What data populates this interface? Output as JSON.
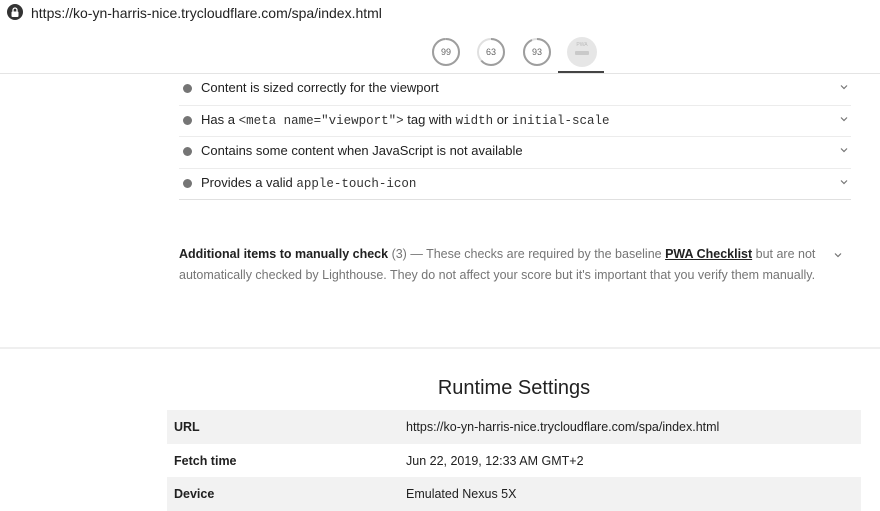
{
  "url_bar": {
    "lock_icon": "lock-icon",
    "url": "https://ko-yn-harris-nice.trycloudflare.com/spa/index.html"
  },
  "scores": [
    {
      "name": "performance",
      "value": "99",
      "fraction": 0.99,
      "color": "#9e9e9e"
    },
    {
      "name": "accessibility",
      "value": "63",
      "fraction": 0.63,
      "color": "#9e9e9e"
    },
    {
      "name": "best-practices",
      "value": "93",
      "fraction": 0.93,
      "color": "#9e9e9e"
    }
  ],
  "pwa_badge": {
    "label": "PWA",
    "icon": "pwa-badge-icon"
  },
  "audits": [
    {
      "parts": [
        {
          "t": "text",
          "v": "Content is sized correctly for the viewport"
        }
      ]
    },
    {
      "parts": [
        {
          "t": "text",
          "v": "Has a "
        },
        {
          "t": "code",
          "v": "<meta name=\"viewport\">"
        },
        {
          "t": "text",
          "v": " tag with "
        },
        {
          "t": "code",
          "v": "width"
        },
        {
          "t": "text",
          "v": " or "
        },
        {
          "t": "code",
          "v": "initial-scale"
        }
      ]
    },
    {
      "parts": [
        {
          "t": "text",
          "v": "Contains some content when JavaScript is not available"
        }
      ]
    },
    {
      "parts": [
        {
          "t": "text",
          "v": "Provides a valid "
        },
        {
          "t": "code",
          "v": "apple-touch-icon"
        }
      ]
    }
  ],
  "manual_check": {
    "title": "Additional items to manually check",
    "count": "(3)",
    "desc_before": " — These checks are required by the baseline ",
    "link": "PWA Checklist",
    "desc_after": " but are not automatically checked by Lighthouse. They do not affect your score but it's important that you verify them manually."
  },
  "runtime": {
    "title": "Runtime Settings",
    "rows": [
      {
        "key": "URL",
        "value": "https://ko-yn-harris-nice.trycloudflare.com/spa/index.html"
      },
      {
        "key": "Fetch time",
        "value": "Jun 22, 2019, 12:33 AM GMT+2"
      },
      {
        "key": "Device",
        "value": "Emulated Nexus 5X"
      }
    ]
  },
  "colors": {
    "bullet": "#757575",
    "text": "#212121",
    "muted": "#757575",
    "row_shade": "#f2f2f2"
  }
}
